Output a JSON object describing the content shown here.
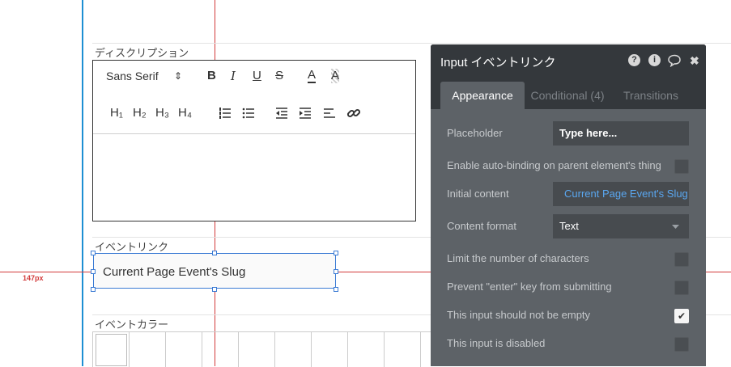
{
  "guides": {
    "offset_label": "147px"
  },
  "groups": {
    "description_label": "ディスクリプション",
    "event_link_label": "イベントリンク",
    "event_color_label": "イベントカラー"
  },
  "editor": {
    "font_family": "Sans Serif",
    "font_arrows": "⇕",
    "bold": "B",
    "italic": "I",
    "underline": "U",
    "strike": "S",
    "color": "A",
    "bg_color": "A",
    "h1": "H₁",
    "h2": "H₂",
    "h3": "H₃",
    "h4": "H₄"
  },
  "input_element": {
    "value": "Current Page Event's Slug"
  },
  "panel": {
    "title": "Input イベントリンク",
    "help_icon": "?",
    "info_icon": "i",
    "comment_icon": "💬",
    "close_icon": "✖",
    "tabs": [
      {
        "label": "Appearance",
        "active": true
      },
      {
        "label": "Conditional (4)",
        "active": false
      },
      {
        "label": "Transitions",
        "active": false
      }
    ],
    "placeholder_label": "Placeholder",
    "placeholder_value": "Type here...",
    "auto_binding_label": "Enable auto-binding on parent element's thing",
    "initial_content_label": "Initial content",
    "initial_content_value": "Current Page Event's Slug",
    "content_format_label": "Content format",
    "content_format_value": "Text",
    "limit_chars_label": "Limit the number of characters",
    "prevent_enter_label": "Prevent \"enter\" key from submitting",
    "not_empty_label": "This input should not be empty",
    "disabled_label": "This input is disabled",
    "checkmark": "✔"
  },
  "colors": {
    "accent_blue": "#5aa7f0",
    "guide_blue": "#1d8fd3",
    "guide_red": "#d23b3b",
    "panel_bg": "#5d6267",
    "panel_header": "#34383c"
  }
}
